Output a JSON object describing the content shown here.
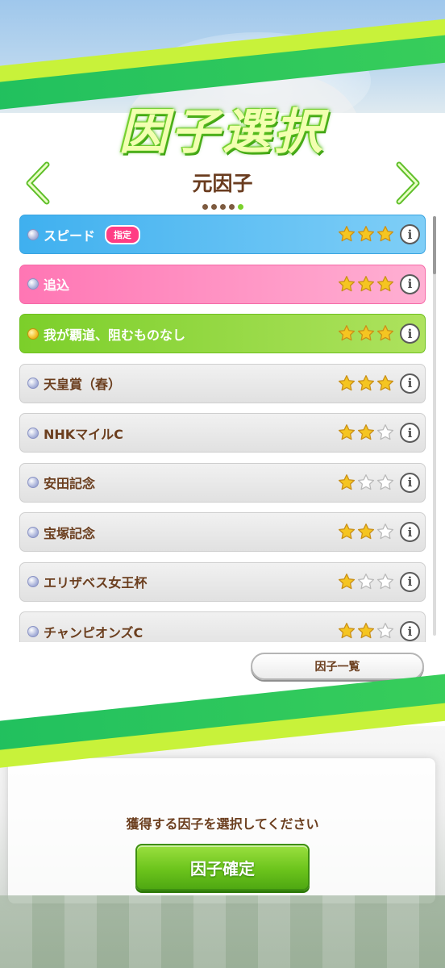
{
  "header": {
    "title": "因子選択",
    "subtitle": "元因子",
    "page_indicator": {
      "total": 5,
      "active": 5
    }
  },
  "factors": [
    {
      "name": "スピード",
      "tag": "指定",
      "stars": 3,
      "color": "blue",
      "bullet": "silver"
    },
    {
      "name": "追込",
      "tag": "",
      "stars": 3,
      "color": "pink",
      "bullet": "silver"
    },
    {
      "name": "我が覇道、阻むものなし",
      "tag": "",
      "stars": 3,
      "color": "green",
      "bullet": "gold"
    },
    {
      "name": "天皇賞（春）",
      "tag": "",
      "stars": 3,
      "color": "gray",
      "bullet": "silver"
    },
    {
      "name": "NHKマイルC",
      "tag": "",
      "stars": 2,
      "color": "gray",
      "bullet": "silver"
    },
    {
      "name": "安田記念",
      "tag": "",
      "stars": 1,
      "color": "gray",
      "bullet": "silver"
    },
    {
      "name": "宝塚記念",
      "tag": "",
      "stars": 2,
      "color": "gray",
      "bullet": "silver"
    },
    {
      "name": "エリザベス女王杯",
      "tag": "",
      "stars": 1,
      "color": "gray",
      "bullet": "silver"
    },
    {
      "name": "チャンピオンズC",
      "tag": "",
      "stars": 2,
      "color": "gray",
      "bullet": "silver"
    }
  ],
  "info_icon_glyph": "i",
  "buttons": {
    "factor_list": "因子一覧",
    "confirm": "因子確定"
  },
  "prompt": "獲得する因子を選択してください",
  "colors": {
    "brown_text": "#6b3e1e",
    "green_accent": "#6cc41c",
    "blue_row": "#3fb0ef",
    "pink_row": "#ff76b4",
    "green_row": "#7ccf2a",
    "tag_pink": "#ff3c84",
    "star_gold": "#f5c521"
  }
}
